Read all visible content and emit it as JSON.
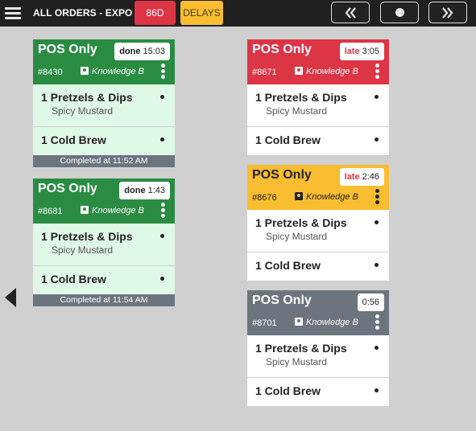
{
  "header": {
    "title": "ALL ORDERS - EXPO",
    "btn_86d": "86D",
    "btn_delays": "DELAYS"
  },
  "colors": {
    "green": "#2a8c43",
    "red": "#dc3545",
    "yellow": "#f8bd30",
    "gray": "#6c757d"
  },
  "tickets": [
    {
      "title": "POS Only",
      "status": "done",
      "timer": "15:03",
      "id": "#8430",
      "server": "Knowledge B",
      "items": [
        {
          "name": "1 Pretzels & Dips",
          "modifier": "Spicy Mustard"
        },
        {
          "name": "1 Cold Brew"
        }
      ],
      "footer": "Completed at 11:52 AM"
    },
    {
      "title": "POS Only",
      "status": "done",
      "timer": "1:43",
      "id": "#8681",
      "server": "Knowledge B",
      "items": [
        {
          "name": "1 Pretzels & Dips",
          "modifier": "Spicy Mustard"
        },
        {
          "name": "1 Cold Brew"
        }
      ],
      "footer": "Completed at 11:54 AM"
    },
    {
      "title": "POS Only",
      "status": "late",
      "timer": "3:05",
      "id": "#8671",
      "server": "Knowledge B",
      "items": [
        {
          "name": "1 Pretzels & Dips",
          "modifier": "Spicy Mustard"
        },
        {
          "name": "1 Cold Brew"
        }
      ]
    },
    {
      "title": "POS Only",
      "status": "late",
      "timer": "2:46",
      "id": "#8676",
      "server": "Knowledge B",
      "items": [
        {
          "name": "1 Pretzels & Dips",
          "modifier": "Spicy Mustard"
        },
        {
          "name": "1 Cold Brew"
        }
      ]
    },
    {
      "title": "POS Only",
      "status": "",
      "timer": "0:56",
      "id": "#8701",
      "server": "Knowledge B",
      "items": [
        {
          "name": "1 Pretzels & Dips",
          "modifier": "Spicy Mustard"
        },
        {
          "name": "1 Cold Brew"
        }
      ]
    }
  ]
}
